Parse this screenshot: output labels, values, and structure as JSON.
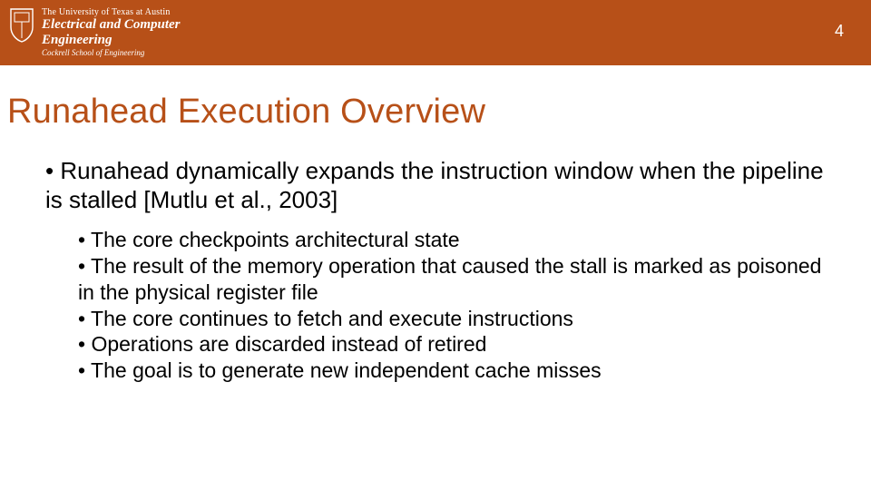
{
  "header": {
    "institution": {
      "line1": "The University of Texas at Austin",
      "line2": "Electrical and Computer",
      "line3": "Engineering",
      "line4": "Cockrell School of Engineering"
    },
    "page_number": "4",
    "bg_color": "#b75018"
  },
  "title": "Runahead Execution Overview",
  "title_color": "#b75018",
  "bullets": [
    {
      "text": "Runahead dynamically expands the instruction window when the pipeline is stalled [Mutlu et al., 2003]",
      "children": [
        "The core checkpoints architectural state",
        "The result of the memory operation that caused the stall is marked as poisoned in the physical register file",
        "The core continues to fetch and execute instructions",
        "Operations are discarded instead of retired",
        "The goal is to generate new independent cache misses"
      ]
    }
  ]
}
